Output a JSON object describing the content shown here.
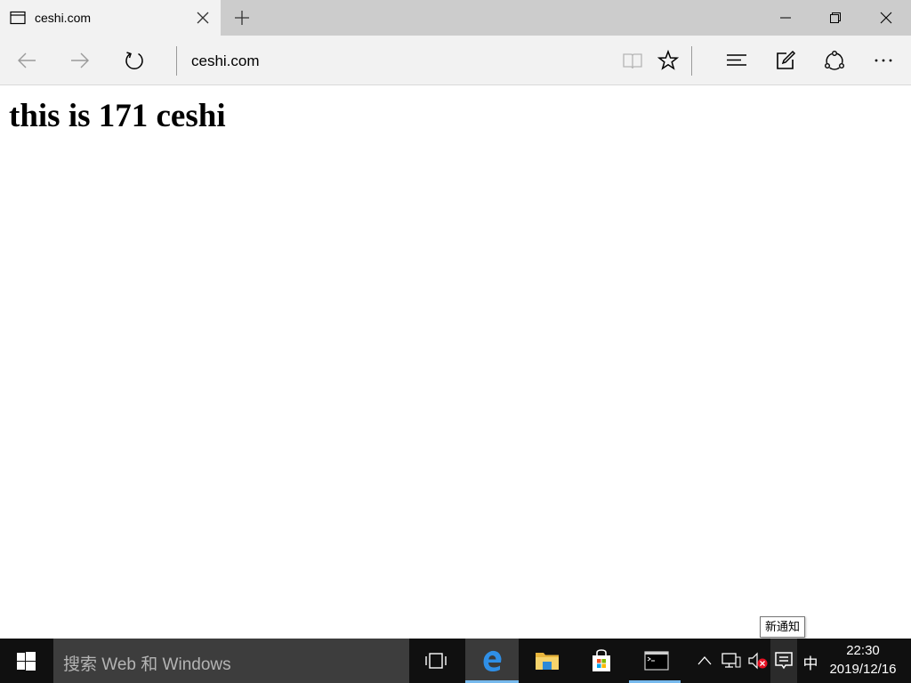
{
  "tab": {
    "title": "ceshi.com",
    "icon": "page-icon"
  },
  "window": {
    "minimize_icon": "minimize-icon",
    "restore_icon": "restore-icon",
    "close_icon": "close-icon"
  },
  "nav": {
    "address": "ceshi.com"
  },
  "page": {
    "heading": "this is 171 ceshi"
  },
  "tooltip": {
    "text": "新通知"
  },
  "taskbar": {
    "search_placeholder": "搜索 Web 和 Windows",
    "ime": "中",
    "time": "22:30",
    "date": "2019/12/16"
  },
  "colors": {
    "accent": "#0078d7",
    "taskbar": "#101010",
    "search_box": "#3d3d3d",
    "tab_active": "#f2f2f2",
    "titlebar": "#cccccc",
    "running_indicator": "#76b9ed"
  }
}
